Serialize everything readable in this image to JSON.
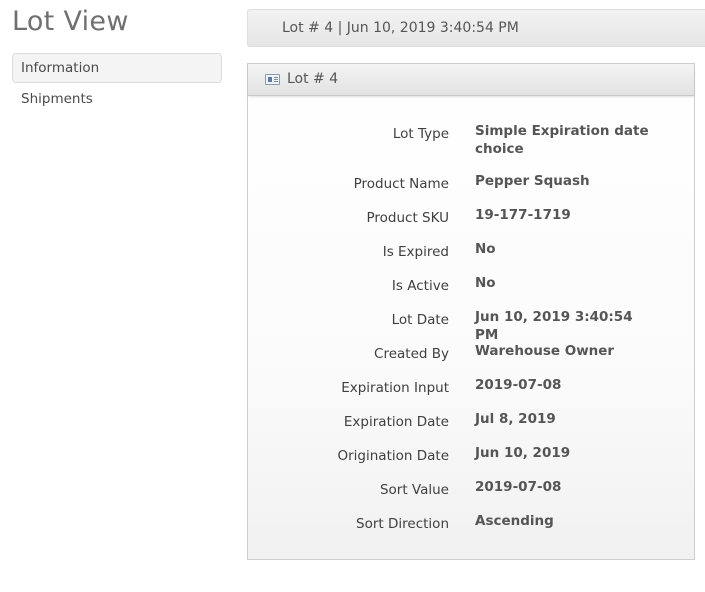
{
  "page": {
    "title": "Lot View"
  },
  "sidebar": {
    "items": [
      {
        "label": "Information",
        "active": true
      },
      {
        "label": "Shipments",
        "active": false
      }
    ]
  },
  "header": {
    "text": "Lot # 4 | Jun 10, 2019 3:40:54 PM"
  },
  "panel": {
    "title": "Lot # 4",
    "icon": "id-card-icon",
    "fields": [
      {
        "label": "Lot Type",
        "value": "Simple Expiration date choice"
      },
      {
        "label": "Product Name",
        "value": "Pepper Squash"
      },
      {
        "label": "Product SKU",
        "value": "19-177-1719"
      },
      {
        "label": "Is Expired",
        "value": "No"
      },
      {
        "label": "Is Active",
        "value": "No"
      },
      {
        "label": "Lot Date",
        "value": "Jun 10, 2019 3:40:54 PM"
      },
      {
        "label": "Created By",
        "value": "Warehouse Owner"
      },
      {
        "label": "Expiration Input",
        "value": "2019-07-08"
      },
      {
        "label": "Expiration Date",
        "value": "Jul 8, 2019"
      },
      {
        "label": "Origination Date",
        "value": "Jun 10, 2019"
      },
      {
        "label": "Sort Value",
        "value": "2019-07-08"
      },
      {
        "label": "Sort Direction",
        "value": "Ascending"
      }
    ]
  }
}
